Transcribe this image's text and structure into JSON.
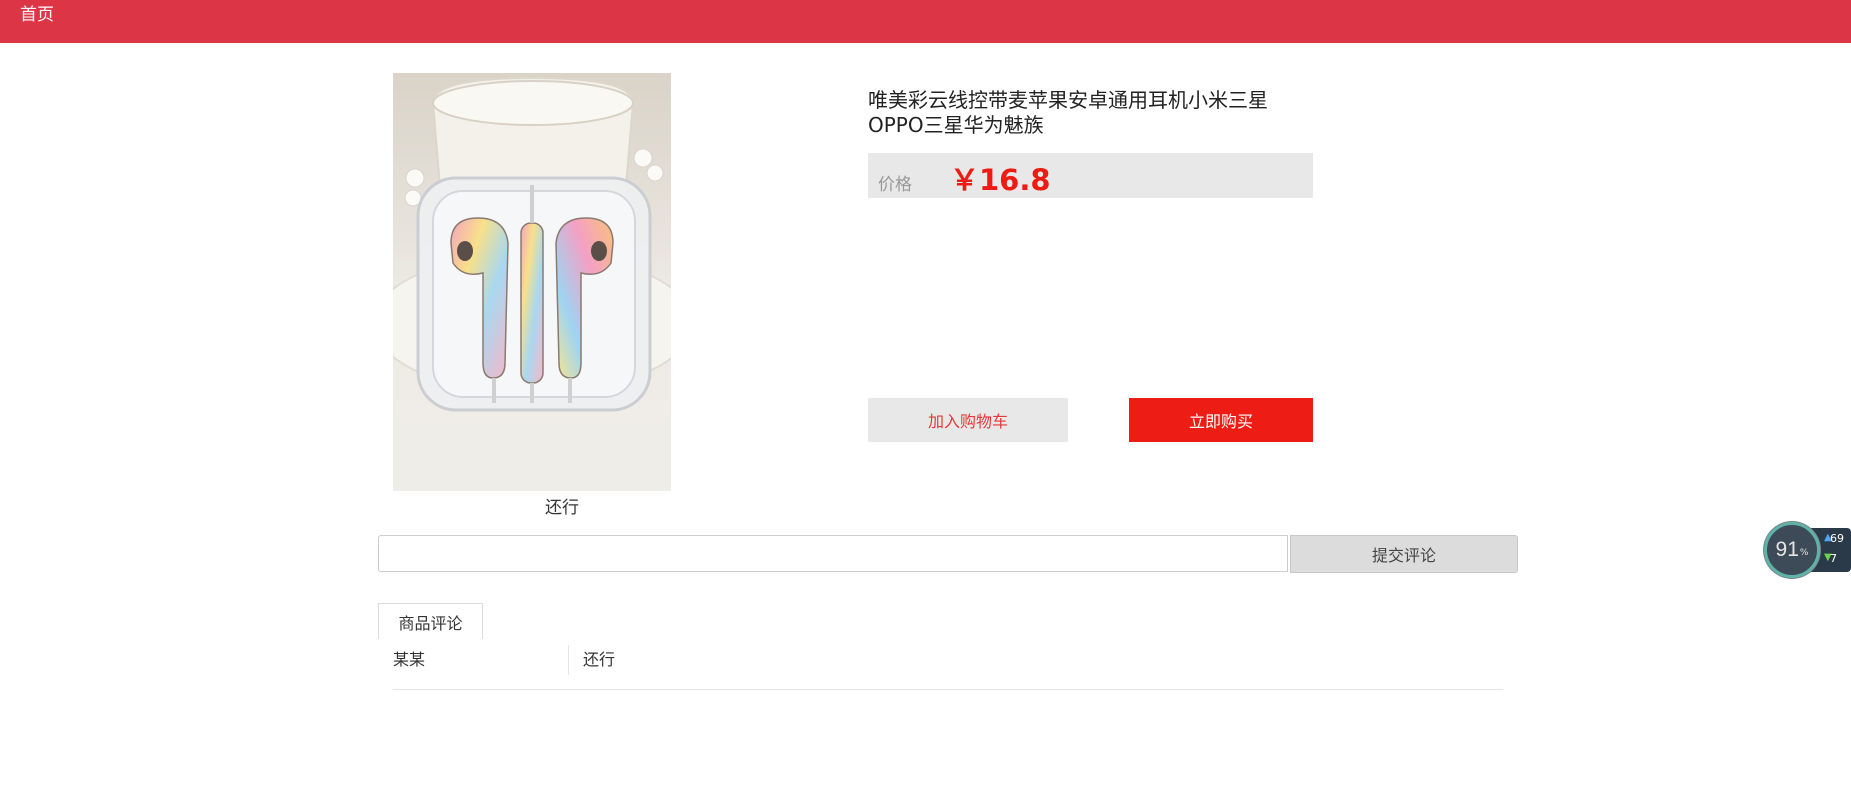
{
  "nav": {
    "home_label": "首页"
  },
  "product": {
    "image_icon": "earphones-product-photo",
    "image_caption": "还行",
    "title_line1": "唯美彩云线控带麦苹果安卓通用耳机小米三星",
    "title_line2": "OPPO三星华为魅族",
    "price_label": "价格",
    "price": "￥16.8",
    "add_to_cart_label": "加入购物车",
    "buy_now_label": "立即购买"
  },
  "comment_form": {
    "input_value": "",
    "input_placeholder": "",
    "submit_label": "提交评论"
  },
  "tabs": [
    {
      "label": "商品评论",
      "active": true
    }
  ],
  "comments": [
    {
      "user": "某某",
      "text": "还行"
    }
  ],
  "speed_widget": {
    "percent": "91",
    "unit": "%",
    "upload": "69",
    "download": "7"
  },
  "colors": {
    "topbar": "#dc3545",
    "price": "#ee1b14",
    "buy_button": "#ed1c15",
    "cart_text": "#e4393c"
  }
}
